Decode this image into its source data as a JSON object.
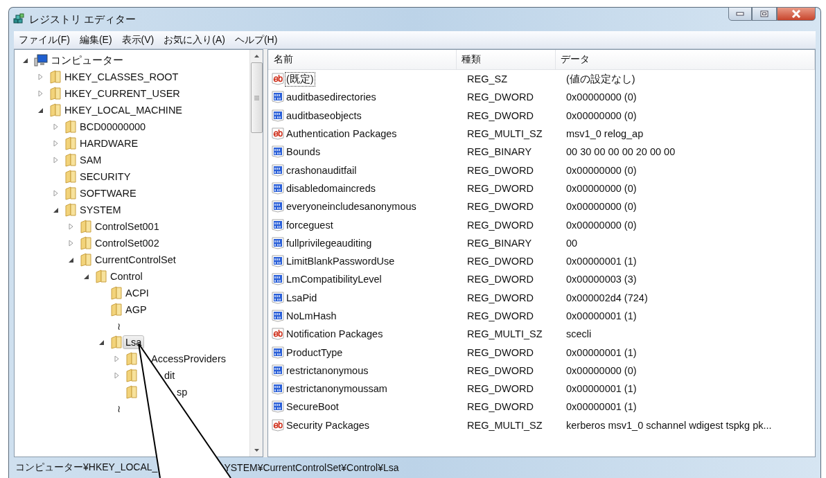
{
  "window": {
    "title": "レジストリ エディター"
  },
  "menu": [
    "ファイル(F)",
    "編集(E)",
    "表示(V)",
    "お気に入り(A)",
    "ヘルプ(H)"
  ],
  "tree": [
    {
      "label": "コンピューター",
      "kind": "computer",
      "expanded": true,
      "selected": false,
      "children": [
        {
          "label": "HKEY_CLASSES_ROOT",
          "kind": "key",
          "expanded": false,
          "selected": false
        },
        {
          "label": "HKEY_CURRENT_USER",
          "kind": "key",
          "expanded": false,
          "selected": false
        },
        {
          "label": "HKEY_LOCAL_MACHINE",
          "kind": "key",
          "expanded": true,
          "selected": false,
          "children": [
            {
              "label": "BCD00000000",
              "kind": "key",
              "expanded": false,
              "selected": false
            },
            {
              "label": "HARDWARE",
              "kind": "key",
              "expanded": false,
              "selected": false
            },
            {
              "label": "SAM",
              "kind": "key",
              "expanded": false,
              "selected": false
            },
            {
              "label": "SECURITY",
              "kind": "key",
              "selected": false
            },
            {
              "label": "SOFTWARE",
              "kind": "key",
              "expanded": false,
              "selected": false
            },
            {
              "label": "SYSTEM",
              "kind": "key",
              "expanded": true,
              "selected": false,
              "children": [
                {
                  "label": "ControlSet001",
                  "kind": "key",
                  "expanded": false,
                  "selected": false
                },
                {
                  "label": "ControlSet002",
                  "kind": "key",
                  "expanded": false,
                  "selected": false
                },
                {
                  "label": "CurrentControlSet",
                  "kind": "key",
                  "expanded": true,
                  "selected": false,
                  "children": [
                    {
                      "label": "Control",
                      "kind": "key",
                      "expanded": true,
                      "selected": false,
                      "children": [
                        {
                          "label": "ACPI",
                          "kind": "key",
                          "selected": false
                        },
                        {
                          "label": "AGP",
                          "kind": "key",
                          "selected": false
                        },
                        {
                          "label": "≀",
                          "kind": "omission"
                        },
                        {
                          "label": "Lsa",
                          "kind": "key",
                          "expanded": true,
                          "selected": true,
                          "children": [
                            {
                              "label": "AccessProviders",
                              "kind": "key",
                              "expanded": false,
                              "selected": false
                            },
                            {
                              "label": "dit",
                              "kind": "key",
                              "expanded": false,
                              "selected": false
                            },
                            {
                              "label": "sp",
                              "kind": "key",
                              "selected": false
                            },
                            {
                              "label": "≀",
                              "kind": "omission"
                            }
                          ]
                        }
                      ]
                    }
                  ]
                }
              ]
            }
          ]
        }
      ]
    }
  ],
  "table": {
    "columns": [
      "名前",
      "種類",
      "データ"
    ],
    "rows": [
      {
        "name": "(既定)",
        "kind": "string",
        "type": "REG_SZ",
        "data": "(値の設定なし)",
        "focused": true
      },
      {
        "name": "auditbasedirectories",
        "kind": "binary",
        "type": "REG_DWORD",
        "data": "0x00000000 (0)",
        "focused": false
      },
      {
        "name": "auditbaseobjects",
        "kind": "binary",
        "type": "REG_DWORD",
        "data": "0x00000000 (0)",
        "focused": false
      },
      {
        "name": "Authentication Packages",
        "kind": "string",
        "type": "REG_MULTI_SZ",
        "data": "msv1_0 relog_ap",
        "focused": false
      },
      {
        "name": "Bounds",
        "kind": "binary",
        "type": "REG_BINARY",
        "data": "00 30 00 00 00 20 00 00",
        "focused": false
      },
      {
        "name": "crashonauditfail",
        "kind": "binary",
        "type": "REG_DWORD",
        "data": "0x00000000 (0)",
        "focused": false
      },
      {
        "name": "disabledomaincreds",
        "kind": "binary",
        "type": "REG_DWORD",
        "data": "0x00000000 (0)",
        "focused": false
      },
      {
        "name": "everyoneincludesanonymous",
        "kind": "binary",
        "type": "REG_DWORD",
        "data": "0x00000000 (0)",
        "focused": false
      },
      {
        "name": "forceguest",
        "kind": "binary",
        "type": "REG_DWORD",
        "data": "0x00000000 (0)",
        "focused": false
      },
      {
        "name": "fullprivilegeauditing",
        "kind": "binary",
        "type": "REG_BINARY",
        "data": "00",
        "focused": false
      },
      {
        "name": "LimitBlankPasswordUse",
        "kind": "binary",
        "type": "REG_DWORD",
        "data": "0x00000001 (1)",
        "focused": false
      },
      {
        "name": "LmCompatibilityLevel",
        "kind": "binary",
        "type": "REG_DWORD",
        "data": "0x00000003 (3)",
        "focused": false
      },
      {
        "name": "LsaPid",
        "kind": "binary",
        "type": "REG_DWORD",
        "data": "0x000002d4 (724)",
        "focused": false
      },
      {
        "name": "NoLmHash",
        "kind": "binary",
        "type": "REG_DWORD",
        "data": "0x00000001 (1)",
        "focused": false
      },
      {
        "name": "Notification Packages",
        "kind": "string",
        "type": "REG_MULTI_SZ",
        "data": "scecli",
        "focused": false
      },
      {
        "name": "ProductType",
        "kind": "binary",
        "type": "REG_DWORD",
        "data": "0x00000001 (1)",
        "focused": false
      },
      {
        "name": "restrictanonymous",
        "kind": "binary",
        "type": "REG_DWORD",
        "data": "0x00000000 (0)",
        "focused": false
      },
      {
        "name": "restrictanonymoussam",
        "kind": "binary",
        "type": "REG_DWORD",
        "data": "0x00000001 (1)",
        "focused": false
      },
      {
        "name": "SecureBoot",
        "kind": "binary",
        "type": "REG_DWORD",
        "data": "0x00000001 (1)",
        "focused": false
      },
      {
        "name": "Security Packages",
        "kind": "string",
        "type": "REG_MULTI_SZ",
        "data": "kerberos msv1_0 schannel wdigest tspkg pk...",
        "focused": false
      }
    ]
  },
  "status_bar": [
    "コンピューター¥HKEY_LOCAL_",
    "YSTEM¥CurrentControlSet¥Control¥Lsa"
  ]
}
